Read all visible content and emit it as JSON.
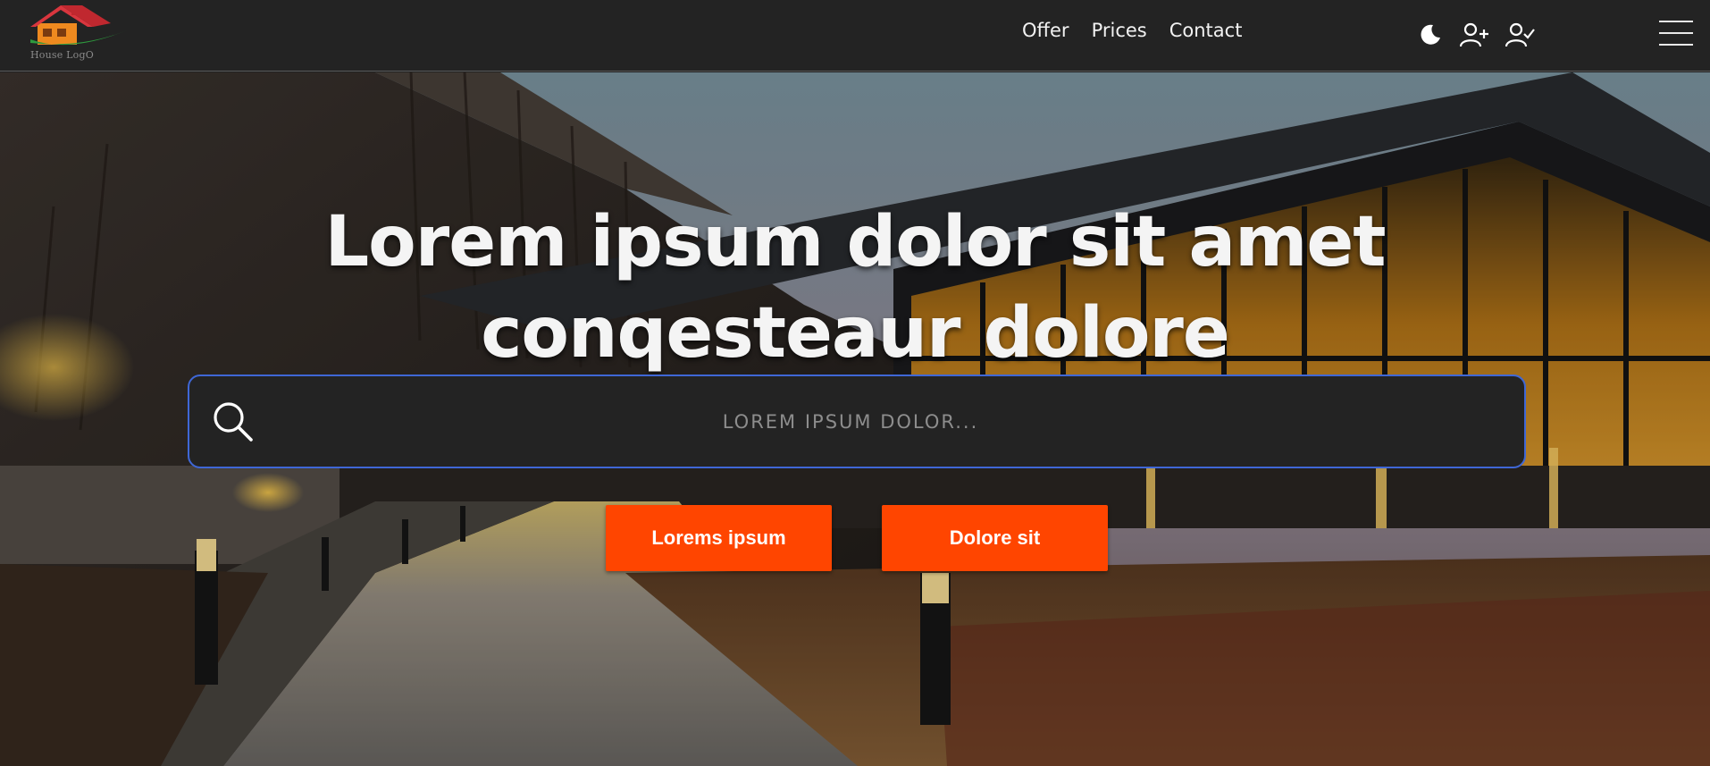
{
  "logo": {
    "text": "House LogO",
    "roof_color": "#d9363e",
    "swoosh_color": "#2e9a3e",
    "house_color": "#ef8a1f"
  },
  "nav": {
    "items": [
      {
        "label": "Offer"
      },
      {
        "label": "Prices"
      },
      {
        "label": "Contact"
      }
    ]
  },
  "header_icons": [
    "moon-icon",
    "user-add-icon",
    "user-check-icon",
    "hamburger-menu-icon"
  ],
  "hero": {
    "title_line1": "Lorem ipsum dolor sit amet",
    "title_line2": "conqesteaur dolore"
  },
  "search": {
    "placeholder": "LOREM IPSUM DOLOR...",
    "value": "",
    "border_color": "#3f67d6"
  },
  "buttons": {
    "primary_label": "Lorems ipsum",
    "secondary_label": "Dolore sit",
    "color": "#ff4500"
  }
}
